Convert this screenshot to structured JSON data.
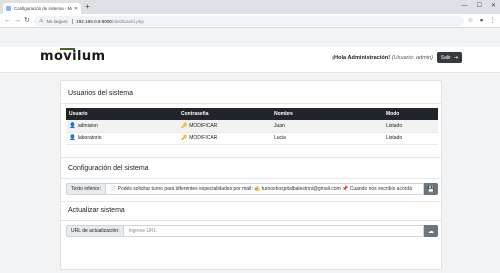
{
  "browser": {
    "tab_title": "Configuración de sistema - Movi…",
    "tab_close": "✕",
    "new_tab": "+",
    "not_secure": "No seguro",
    "url_host": "192.168.0.9:8000",
    "url_path": "/dashboard.php"
  },
  "navbar": {
    "logo": "movilum",
    "welcome_bold": "¡Hola Administración!",
    "welcome_role": "(Usuario: admin)",
    "exit_label": "Salir"
  },
  "users": {
    "title": "Usuarios del sistema",
    "columns": [
      "Usuario",
      "Contraseña",
      "Nombre",
      "Modo"
    ],
    "rows": [
      {
        "usuario": "admision",
        "contrasena": "MODIFICAR",
        "nombre": "Juan",
        "modo": "Listado"
      },
      {
        "usuario": "laboratorio",
        "contrasena": "MODIFICAR",
        "nombre": "Lucia",
        "modo": "Listado"
      }
    ]
  },
  "config": {
    "title": "Configuración del sistema",
    "text_label": "Texto inferior:",
    "text_value": "📄 Podés solicitar turno para diferentes especialidades por mail: ✍ turnoshospitalbalestrini@gmail.com 📌 Cuando nos escribís acordá"
  },
  "update": {
    "title": "Actualizar sistema",
    "url_label": "URL de actualización:",
    "url_placeholder": "Ingrese URL"
  },
  "icons": {
    "save": "💾",
    "download": "☁"
  }
}
